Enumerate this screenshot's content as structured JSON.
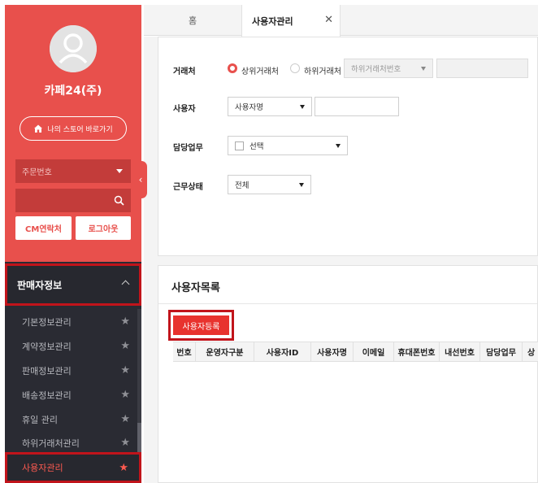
{
  "sidebar": {
    "shop_name": "카페24(주)",
    "store_button_label": "나의 스토어 바로가기",
    "order_select": {
      "value": "주문번호"
    },
    "cm_button_label": "CM연락처",
    "logout_button_label": "로그아웃",
    "section_title": "판매자정보",
    "menu_items": [
      {
        "label": "기본정보관리"
      },
      {
        "label": "계약정보관리"
      },
      {
        "label": "판매정보관리"
      },
      {
        "label": "배송정보관리"
      },
      {
        "label": "휴일 관리"
      },
      {
        "label": "하위거래처관리"
      },
      {
        "label": "사용자관리"
      }
    ],
    "colors": {
      "accent": "#e8504c",
      "dark": "#2a2b33",
      "highlight": "#c1141b"
    }
  },
  "tabs": [
    {
      "label": "홈"
    },
    {
      "label": "사용자관리"
    }
  ],
  "filter": {
    "vendor_label": "거래처",
    "vendor_radio_upper": "상위거래처",
    "vendor_radio_lower": "하위거래처",
    "vendor_code_placeholder": "하위거래처번호",
    "user_label": "사용자",
    "user_select_value": "사용자명",
    "duty_label": "담당업무",
    "duty_select_value": "선택",
    "status_label": "근무상태",
    "status_select_value": "전체"
  },
  "list": {
    "title": "사용자목록",
    "register_button_label": "사용자등록",
    "columns": [
      "번호",
      "운영자구분",
      "사용자ID",
      "사용자명",
      "이메일",
      "휴대폰번호",
      "내선번호",
      "담당업무",
      "상"
    ]
  }
}
